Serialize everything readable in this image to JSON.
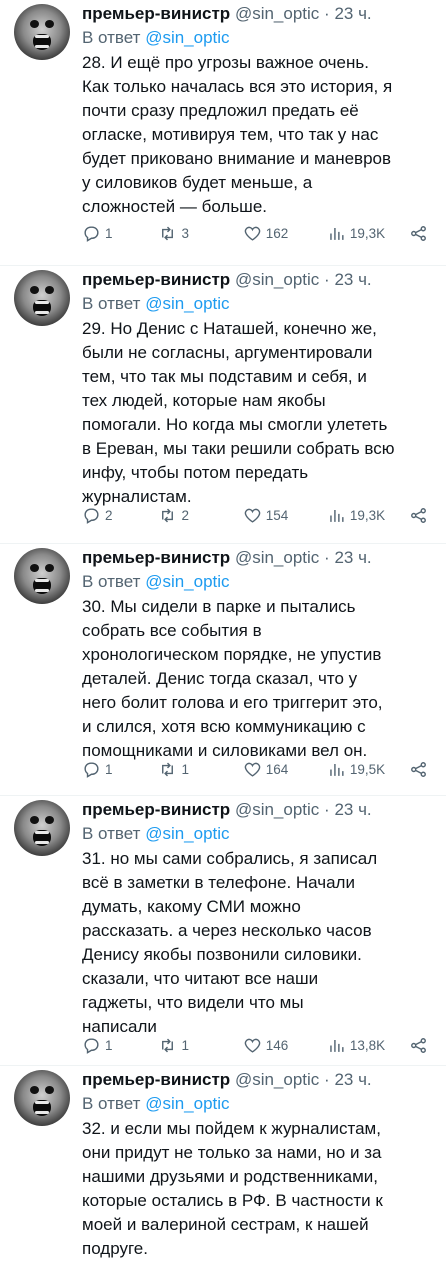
{
  "tweets": [
    {
      "author_name": "премьер-винистр",
      "handle": "@sin_optic",
      "separator": "·",
      "time": "23 ч.",
      "reply_prefix": "В ответ",
      "reply_mention": "@sin_optic",
      "text": "28. И ещё про угрозы важное очень.\nКак только началась вся это история, я\nпочти сразу предложил предать её\nогласке, мотивируя тем, что так у нас\nбудет приковано внимание и маневров\nу силовиков будет меньше, а\nсложностей — больше.",
      "replies": "1",
      "retweets": "3",
      "likes": "162",
      "views": "19,3K"
    },
    {
      "author_name": "премьер-винистр",
      "handle": "@sin_optic",
      "separator": "·",
      "time": "23 ч.",
      "reply_prefix": "В ответ",
      "reply_mention": "@sin_optic",
      "text": "29. Но Денис с Наташей, конечно же,\nбыли не согласны, аргументировали\nтем, что так мы подставим и себя, и\nтех людей, которые нам якобы\nпомогали. Но когда мы смогли улететь\nв Ереван, мы таки решили собрать всю\nинфу, чтобы потом передать\nжурналистам.",
      "replies": "2",
      "retweets": "2",
      "likes": "154",
      "views": "19,3K"
    },
    {
      "author_name": "премьер-винистр",
      "handle": "@sin_optic",
      "separator": "·",
      "time": "23 ч.",
      "reply_prefix": "В ответ",
      "reply_mention": "@sin_optic",
      "text": "30. Мы сидели в парке и пытались\nсобрать все события в\nхронологическом порядке, не упустив\nдеталей. Денис тогда сказал, что у\nнего болит голова и его триггерит это,\nи слился, хотя всю коммуникацию с\nпомощниками и силовиками вел он.",
      "replies": "1",
      "retweets": "1",
      "likes": "164",
      "views": "19,5K"
    },
    {
      "author_name": "премьер-винистр",
      "handle": "@sin_optic",
      "separator": "·",
      "time": "23 ч.",
      "reply_prefix": "В ответ",
      "reply_mention": "@sin_optic",
      "text": "31. но мы сами собрались, я записал\nвсё в заметки в телефоне. Начали\nдумать, какому СМИ можно\nрассказать. а через несколько часов\nДенису якобы позвонили силовики.\nсказали, что читают все наши\nгаджеты, что видели что мы\nнаписали",
      "replies": "1",
      "retweets": "1",
      "likes": "146",
      "views": "13,8K"
    },
    {
      "author_name": "премьер-винистр",
      "handle": "@sin_optic",
      "separator": "·",
      "time": "23 ч.",
      "reply_prefix": "В ответ",
      "reply_mention": "@sin_optic",
      "text": "32. и если мы пойдем к журналистам,\nони придут не только за нами, но и за\nнашими друзьями и родственниками,\nкоторые остались в РФ. В частности к\nмоей и валериной сестрам, к нашей\nподруге."
    }
  ],
  "more_label": "···",
  "colors": {
    "text": "#0f1419",
    "secondary": "#536471",
    "link": "#1d9bf0",
    "divider": "#eff3f4"
  }
}
